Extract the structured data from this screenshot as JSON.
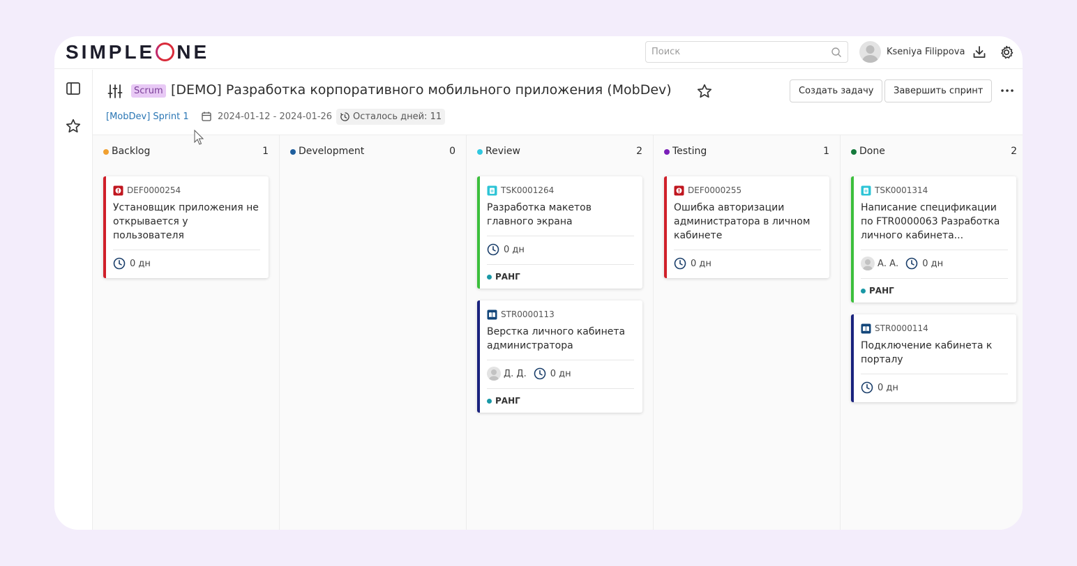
{
  "app": {
    "logo_text_a": "SIMPLE",
    "logo_text_b": "NE"
  },
  "topbar": {
    "search_placeholder": "Поиск",
    "user_name": "Kseniya Filippova"
  },
  "header": {
    "badge": "Scrum",
    "title": "[DEMO] Разработка корпоративного мобильного приложения (MobDev)",
    "create_task_label": "Создать задачу",
    "finish_sprint_label": "Завершить спринт",
    "sprint_name": "[MobDev] Sprint 1",
    "dates": "2024-01-12 - 2024-01-26",
    "days_left": "Осталось дней: 11"
  },
  "columns": [
    {
      "name": "Backlog",
      "count": "1",
      "color": "#f0a030",
      "cards": [
        {
          "id": "DEF0000254",
          "type": "defect",
          "title": "Установщик приложения не открывается у пользователя",
          "duration": "0 дн",
          "accent": "#d0202a"
        }
      ]
    },
    {
      "name": "Development",
      "count": "0",
      "color": "#1f5f9e",
      "cards": []
    },
    {
      "name": "Review",
      "count": "2",
      "color": "#30c8e0",
      "cards": [
        {
          "id": "TSK0001264",
          "type": "task",
          "title": "Разработка макетов главного экрана",
          "duration": "0 дн",
          "tag": "РАНГ",
          "accent": "#3cbf3c"
        },
        {
          "id": "STR0000113",
          "type": "story",
          "title": "Верстка личного кабинета администратора",
          "assignee": "Д. Д.",
          "duration": "0 дн",
          "tag": "РАНГ",
          "accent": "#1a237e"
        }
      ]
    },
    {
      "name": "Testing",
      "count": "1",
      "color": "#7a1fb8",
      "cards": [
        {
          "id": "DEF0000255",
          "type": "defect",
          "title": "Ошибка авторизации администратора в личном кабинете",
          "duration": "0 дн",
          "accent": "#d0202a"
        }
      ]
    },
    {
      "name": "Done",
      "count": "2",
      "color": "#157a3c",
      "cards": [
        {
          "id": "TSK0001314",
          "type": "task",
          "title": "Написание спецификации по FTR0000063 Разработка личного кабинета...",
          "assignee": "А. А.",
          "duration": "0 дн",
          "tag": "РАНГ",
          "accent": "#3cbf3c"
        },
        {
          "id": "STR0000114",
          "type": "story",
          "title": "Подключение кабинета к порталу",
          "duration": "0 дн",
          "accent": "#1a237e"
        }
      ]
    }
  ]
}
